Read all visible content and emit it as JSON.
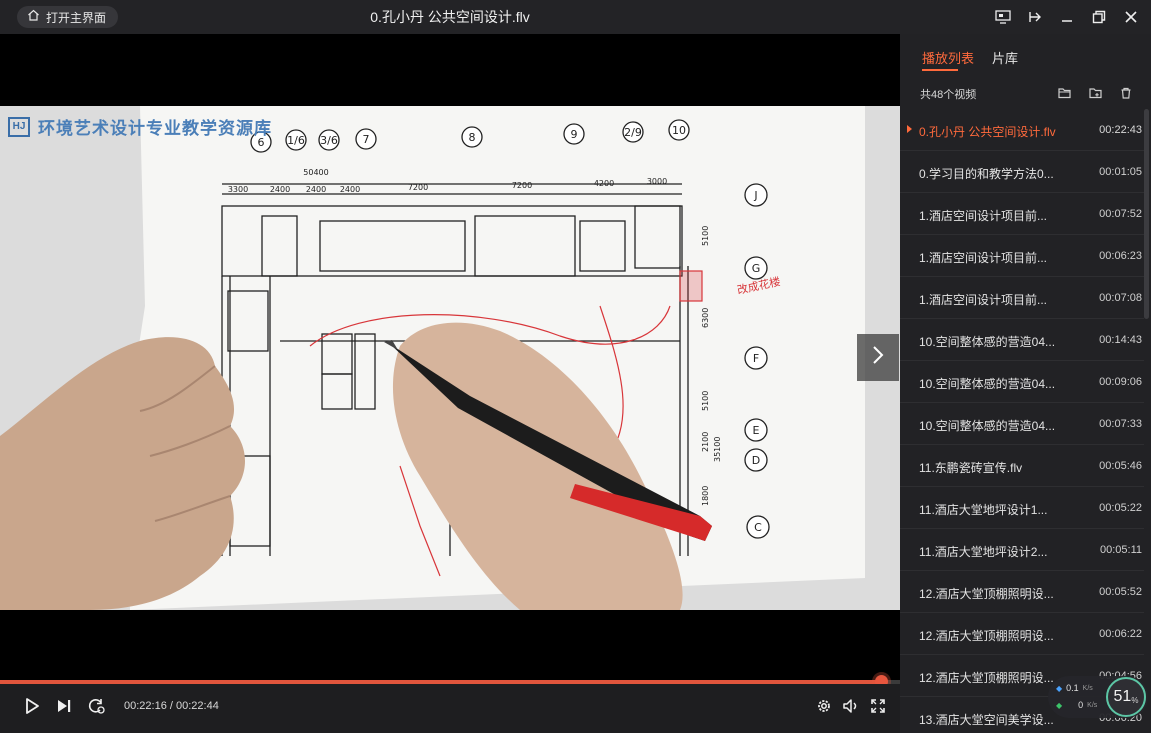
{
  "titlebar": {
    "home_label": "打开主界面",
    "title": "0.孔小丹 公共空间设计.flv",
    "icons": [
      "cast-screen-icon",
      "pin-icon",
      "minimize-icon",
      "restore-icon",
      "close-icon"
    ]
  },
  "video": {
    "watermark": "环境艺术设计专业教学资源库",
    "watermark_logo": "HJ",
    "plan": {
      "axis_top": [
        "6",
        "1/6",
        "3/6",
        "7",
        "8",
        "9",
        "2/9",
        "10"
      ],
      "axis_right": [
        "J",
        "G",
        "F",
        "E",
        "D",
        "C"
      ],
      "dims_top": [
        "3300",
        "2400",
        "2400",
        "2400",
        "7200",
        "7200",
        "4200",
        "3000"
      ],
      "dim_total": "50400",
      "dims_right": [
        "5100",
        "6300",
        "5100",
        "2100",
        "35100",
        "1800"
      ],
      "handnote": "改成花楼"
    }
  },
  "player": {
    "current_time": "00:22:16",
    "total_time": "00:22:44",
    "time_separator": " / ",
    "progress_fraction": 0.979
  },
  "sidebar": {
    "tab_playlist": "播放列表",
    "tab_library": "片库",
    "count": "共48个视频",
    "items": [
      {
        "name": "0.孔小丹 公共空间设计.flv",
        "duration": "00:22:43",
        "active": true
      },
      {
        "name": "0.学习目的和教学方法0...",
        "duration": "00:01:05"
      },
      {
        "name": "1.酒店空间设计项目前...",
        "duration": "00:07:52"
      },
      {
        "name": "1.酒店空间设计项目前...",
        "duration": "00:06:23"
      },
      {
        "name": "1.酒店空间设计项目前...",
        "duration": "00:07:08"
      },
      {
        "name": "10.空间整体感的营造04...",
        "duration": "00:14:43"
      },
      {
        "name": "10.空间整体感的营造04...",
        "duration": "00:09:06"
      },
      {
        "name": "10.空间整体感的营造04...",
        "duration": "00:07:33"
      },
      {
        "name": "11.东鹏瓷砖宣传.flv",
        "duration": "00:05:46"
      },
      {
        "name": "11.酒店大堂地坪设计1...",
        "duration": "00:05:22"
      },
      {
        "name": "11.酒店大堂地坪设计2...",
        "duration": "00:05:11"
      },
      {
        "name": "12.酒店大堂顶棚照明设...",
        "duration": "00:05:52"
      },
      {
        "name": "12.酒店大堂顶棚照明设...",
        "duration": "00:06:22"
      },
      {
        "name": "12.酒店大堂顶棚照明设...",
        "duration": "00:04:56"
      },
      {
        "name": "13.酒店大堂空间美学设...",
        "duration": "00:06:20"
      }
    ]
  },
  "netspeed": {
    "up": "0.1",
    "up_unit": "K/s",
    "down": "0",
    "down_unit": "K/s",
    "percent": "51",
    "percent_sign": "%",
    "up_color": "#4aa3ff",
    "down_color": "#3cc36a"
  },
  "colors": {
    "accent": "#ff6a3c",
    "progress": "#e0553c"
  }
}
